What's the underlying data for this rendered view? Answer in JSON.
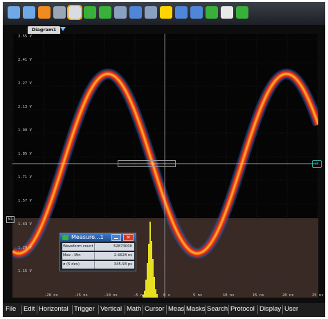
{
  "toolbar": {
    "buttons": [
      {
        "name": "undo-icon",
        "color": "#6ea8e6"
      },
      {
        "name": "redo-icon",
        "color": "#6ea8e6"
      },
      {
        "name": "help-icon",
        "color": "#f08b20"
      },
      {
        "name": "grid-icon",
        "color": "#9aa5b5"
      },
      {
        "name": "pointer-icon",
        "color": "#d9dde3",
        "selected": true
      },
      {
        "name": "zoom-cursor-icon",
        "color": "#38b03a"
      },
      {
        "name": "magnify-icon",
        "color": "#38b03a"
      },
      {
        "name": "waveform-icon",
        "color": "#8aa0c0"
      },
      {
        "name": "split-view-icon",
        "color": "#4f86d8"
      },
      {
        "name": "save-icon",
        "color": "#8aa0c0"
      },
      {
        "name": "marker-icon",
        "color": "#ffd400"
      },
      {
        "name": "histogram-icon",
        "color": "#4f86d8"
      },
      {
        "name": "search-icon",
        "color": "#4f86d8"
      },
      {
        "name": "multi-zoom-icon",
        "color": "#38b03a"
      },
      {
        "name": "clipboard-icon",
        "color": "#e8e8e8"
      },
      {
        "name": "document-icon",
        "color": "#38b03a"
      }
    ]
  },
  "diagram_tab": {
    "label": "Diagram1"
  },
  "reference_marker": "R",
  "n_marker": "N1",
  "y_axis_labels": [
    "2.55 V",
    "2.41 V",
    "2.27 V",
    "2.13 V",
    "1.99 V",
    "1.85 V",
    "1.71 V",
    "1.57 V",
    "1.43 V",
    "1.29 V",
    "1.15 V"
  ],
  "x_axis_labels": [
    "-20 ns",
    "-15 ns",
    "-10 ns",
    "-5 ns",
    "0 s",
    "5 ns",
    "10 ns",
    "15 ns",
    "20 ns",
    "25 ns"
  ],
  "measure": {
    "title": "Measure...1",
    "rows": [
      {
        "name": "Waveform count",
        "value": "52873000"
      },
      {
        "name": "Max - Min",
        "value": "2.4628 ns"
      },
      {
        "name": "σ (5 dev)",
        "value": "345.93 ps"
      }
    ]
  },
  "menu": [
    "File",
    "Edit",
    "Horizontal",
    "Trigger",
    "Vertical",
    "Math",
    "Cursor",
    "Meas",
    "Masks",
    "Search",
    "Protocol",
    "Display",
    "User"
  ],
  "colors": {
    "trace_core": "#ff7a00",
    "trace_mid": "#d8261a",
    "trace_edge": "#1d5fb8",
    "histogram": "#e7e020",
    "histogram_area": "#3a2a26"
  }
}
